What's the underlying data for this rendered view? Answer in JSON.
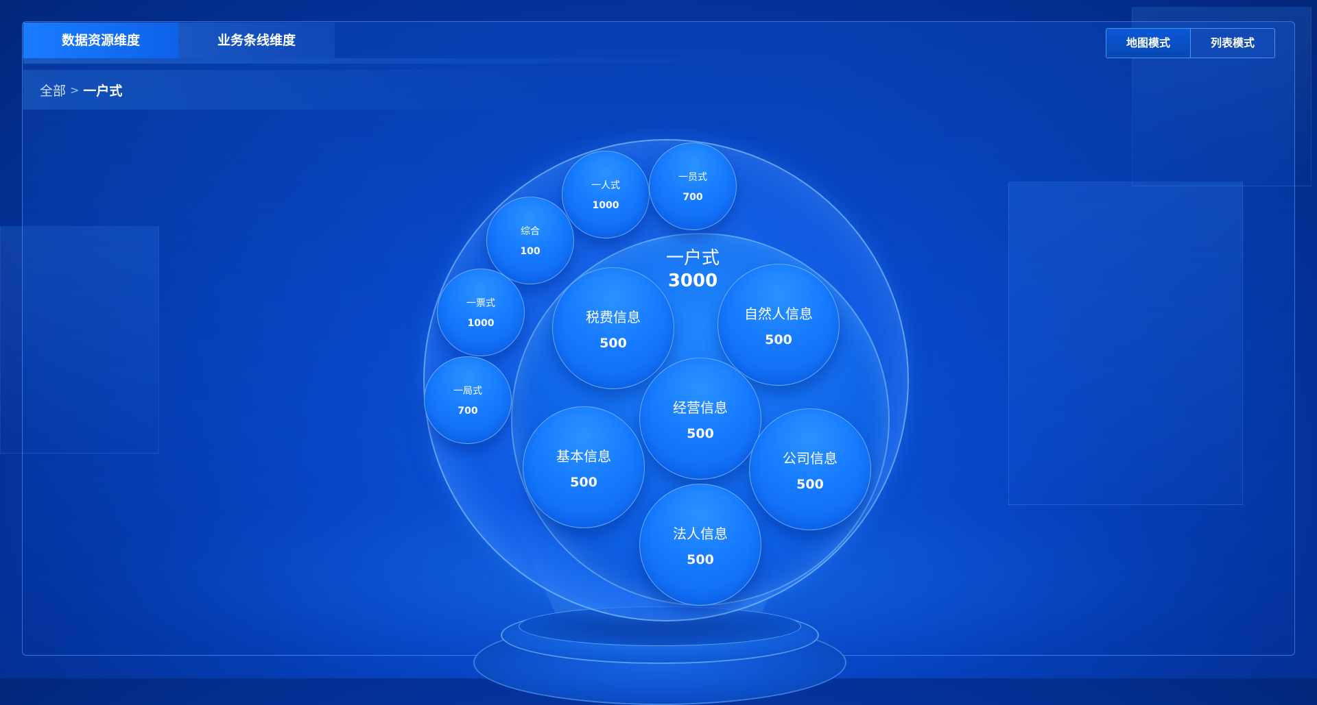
{
  "tabs": [
    {
      "label": "数据资源维度",
      "active": true
    },
    {
      "label": "业务条线维度",
      "active": false
    }
  ],
  "view_modes": [
    {
      "label": "地图模式",
      "active": true
    },
    {
      "label": "列表模式",
      "active": false
    }
  ],
  "breadcrumb": {
    "root": "全部",
    "separator": ">",
    "current": "一户式"
  },
  "center": {
    "name": "一户式",
    "value": "3000"
  },
  "inner_bubbles": [
    {
      "name": "税费信息",
      "value": "500"
    },
    {
      "name": "自然人信息",
      "value": "500"
    },
    {
      "name": "经营信息",
      "value": "500"
    },
    {
      "name": "基本信息",
      "value": "500"
    },
    {
      "name": "公司信息",
      "value": "500"
    },
    {
      "name": "法人信息",
      "value": "500"
    }
  ],
  "outer_bubbles": [
    {
      "name": "一人式",
      "value": "1000"
    },
    {
      "name": "一员式",
      "value": "700"
    },
    {
      "name": "综合",
      "value": "100"
    },
    {
      "name": "一票式",
      "value": "1000"
    },
    {
      "name": "一局式",
      "value": "700"
    }
  ],
  "colors": {
    "accent": "#1a7cff",
    "background": "#03339b",
    "border": "#5aaaff"
  }
}
